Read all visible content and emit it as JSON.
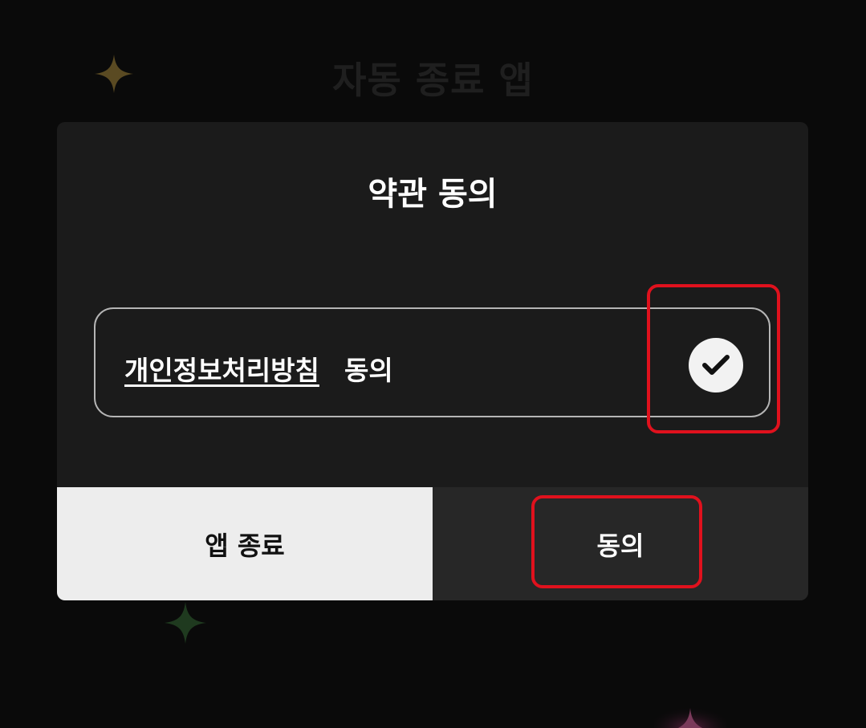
{
  "background": {
    "title": "자동 종료 앱"
  },
  "dialog": {
    "title": "약관 동의",
    "agreement": {
      "link_label": "개인정보처리방침",
      "suffix_label": "동의",
      "checked": true
    },
    "buttons": {
      "exit_label": "앱 종료",
      "agree_label": "동의"
    }
  },
  "colors": {
    "highlight": "#e0111d",
    "dialog_bg": "#1b1b1b",
    "exit_button_bg": "#ededed",
    "agree_button_bg": "#272727"
  },
  "icons": {
    "check": "checkmark-icon",
    "sparkles": [
      "sparkle-icon",
      "sparkle-icon",
      "sparkle-icon"
    ]
  }
}
